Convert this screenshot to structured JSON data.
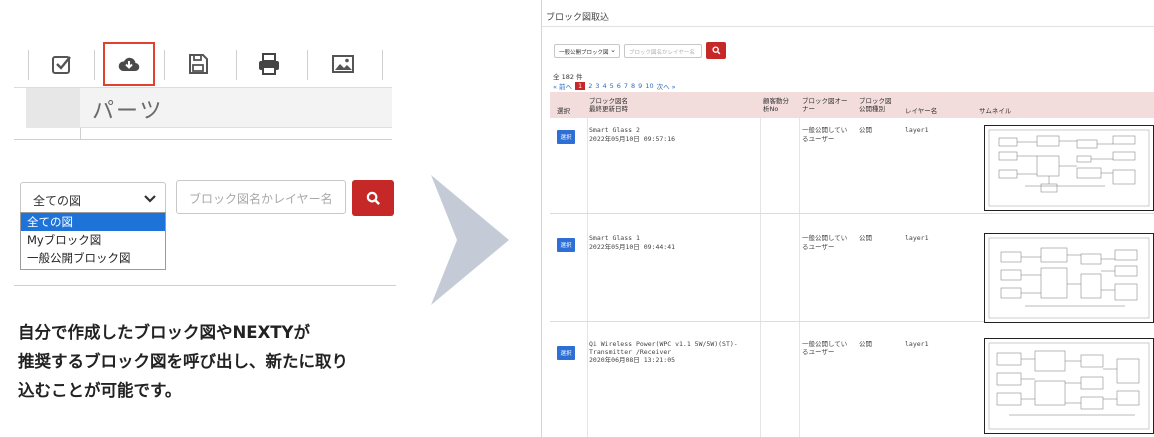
{
  "toolbar": {
    "tools": [
      {
        "name": "check-icon",
        "active": false
      },
      {
        "name": "cloud-download-icon",
        "active": true
      },
      {
        "name": "save-icon",
        "active": false
      },
      {
        "name": "print-icon",
        "active": false
      },
      {
        "name": "image-icon",
        "active": false
      }
    ],
    "parts_label": "パーツ",
    "active_border_color": "#e2412e"
  },
  "search": {
    "select_value": "全ての図",
    "placeholder": "ブロック図名かレイヤー名",
    "button_icon": "search-icon",
    "button_color": "#c62828",
    "options": [
      "全ての図",
      "Myブロック図",
      "一般公開ブロック図"
    ],
    "selected_color": "#1e73d8"
  },
  "caption": {
    "lines": [
      "自分で作成したブロック図やNEXTYが",
      "推奨するブロック図を呼び出し、新たに取り",
      "込むことが可能です。"
    ]
  },
  "screen": {
    "title": "ブロック図取込",
    "select_value": "一般公開ブロック図",
    "placeholder": "ブロック図名かレイヤー名",
    "count_text": "全 182 件",
    "pager": {
      "prev": "« 前へ",
      "current": "1",
      "pages": [
        "2",
        "3",
        "4",
        "5",
        "6",
        "7",
        "8",
        "9",
        "10"
      ],
      "next": "次へ »"
    },
    "columns": {
      "select": "選択",
      "name_line1": "ブロック図名",
      "name_line2": "最終更新日時",
      "customer_line1": "顧客動分",
      "customer_line2": "析No",
      "owner_line1": "ブロック図オー",
      "owner_line2": "ナー",
      "publish_line1": "ブロック図",
      "publish_line2": "公開種別",
      "layer": "レイヤー名",
      "thumb": "サムネイル"
    },
    "rows": [
      {
        "button": "選択",
        "name": [
          "Smart Glass 2"
        ],
        "date": "2022年05月10日 09:57:16",
        "owner": [
          "一般公開してい",
          "るユーザー"
        ],
        "publish": "公開",
        "layer": "layer1"
      },
      {
        "button": "選択",
        "name": [
          "Smart Glass 1"
        ],
        "date": "2022年05月10日 09:44:41",
        "owner": [
          "一般公開してい",
          "るユーザー"
        ],
        "publish": "公開",
        "layer": "layer1"
      },
      {
        "button": "選択",
        "name": [
          "Qi Wireless Power(WPC v1.1 5W/5W)(ST)-",
          "Transmitter /Receiver"
        ],
        "date": "2020年06月08日 13:21:05",
        "owner": [
          "一般公開してい",
          "るユーザー"
        ],
        "publish": "公開",
        "layer": "layer1"
      }
    ],
    "header_color": "#f2dcdc",
    "select_button_color": "#2d6fd6"
  },
  "arrow_color": "#c5cbd6"
}
